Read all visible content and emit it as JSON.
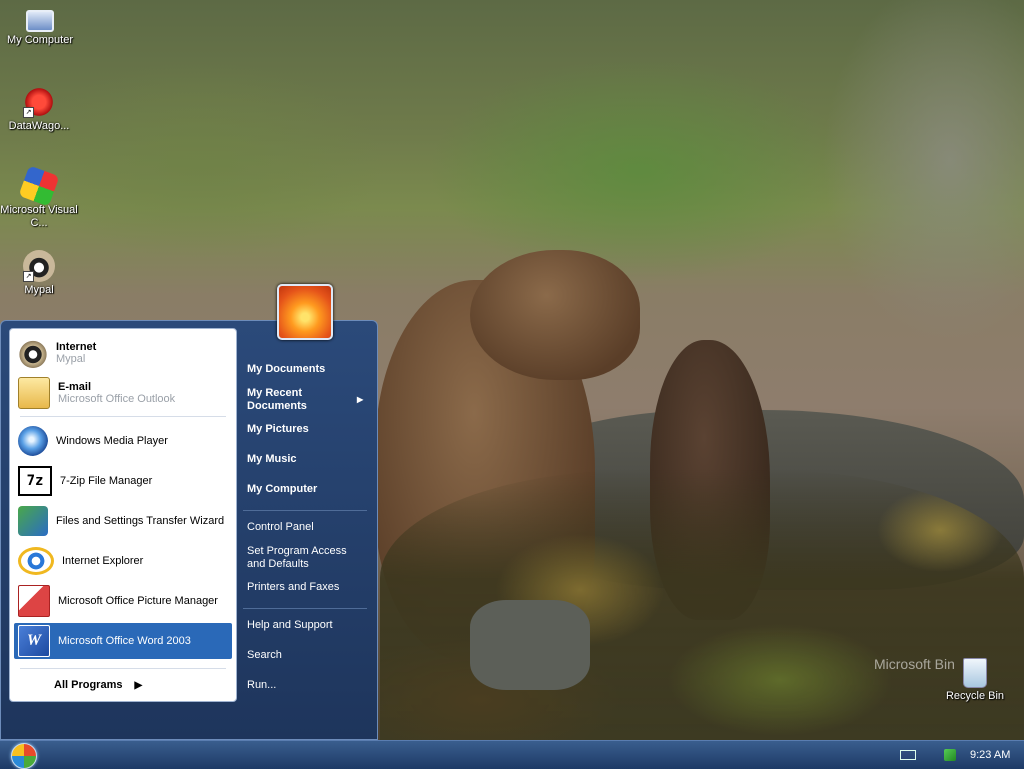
{
  "desktop": {
    "icons": [
      {
        "label": "My Computer",
        "icon": "my-computer-icon"
      },
      {
        "label": "DataWago...",
        "icon": "datawago-icon"
      },
      {
        "label": "Microsoft Visual C...",
        "icon": "visual-c-icon"
      },
      {
        "label": "Mypal",
        "icon": "mypal-icon"
      },
      {
        "label": "Recycle Bin",
        "icon": "recycle-bin-icon"
      }
    ],
    "watermark": "Microsoft Bin"
  },
  "start_menu": {
    "pinned": [
      {
        "title": "Internet",
        "subtitle": "Mypal",
        "icon": "mypal-icon"
      },
      {
        "title": "E-mail",
        "subtitle": "Microsoft Office Outlook",
        "icon": "outlook-icon"
      }
    ],
    "recent": [
      {
        "label": "Windows Media Player",
        "icon": "media-player-icon"
      },
      {
        "label": "7-Zip File Manager",
        "icon": "7zip-icon",
        "glyph": "7z"
      },
      {
        "label": "Files and Settings Transfer Wizard",
        "icon": "transfer-wizard-icon"
      },
      {
        "label": "Internet Explorer",
        "icon": "internet-explorer-icon"
      },
      {
        "label": "Microsoft Office Picture Manager",
        "icon": "picture-manager-icon"
      },
      {
        "label": "Microsoft Office Word 2003",
        "icon": "word-icon",
        "glyph": "W",
        "selected": true
      }
    ],
    "all_programs": "All Programs",
    "right": {
      "my_documents": "My Documents",
      "my_recent_documents_line1": "My Recent",
      "my_recent_documents_line2": "Documents",
      "my_pictures": "My Pictures",
      "my_music": "My Music",
      "my_computer": "My Computer",
      "control_panel": "Control Panel",
      "set_program_access_line1": "Set Program Access",
      "set_program_access_line2": "and Defaults",
      "printers_and_faxes": "Printers and Faxes",
      "help_and_support": "Help and Support",
      "search": "Search",
      "run": "Run..."
    }
  },
  "taskbar": {
    "clock": "9:23 AM"
  },
  "colors": {
    "start_menu_bg": "#1e355c",
    "selection": "#2a69b8",
    "taskbar": "#1d3a66"
  }
}
